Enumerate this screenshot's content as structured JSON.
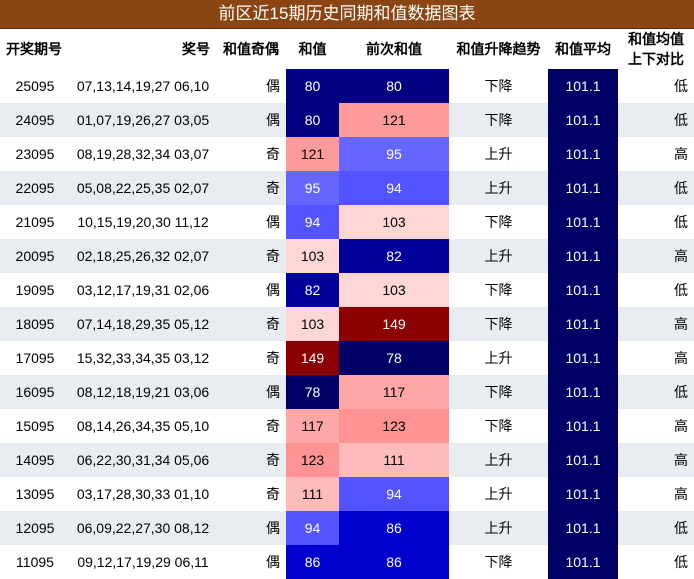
{
  "title": "前区近15期历史同期和值数据图表",
  "headers": [
    "开奖期号",
    "奖号",
    "和值奇偶",
    "和值",
    "前次和值",
    "和值升降趋势",
    "和值平均",
    "和值均值上下对比"
  ],
  "rows": [
    {
      "issue": "25095",
      "numbers": "07,13,14,19,27 06,10",
      "parity": "偶",
      "sum": 80,
      "prev": 80,
      "trend": "下降",
      "avg": "101.1",
      "cmp": "低"
    },
    {
      "issue": "24095",
      "numbers": "01,07,19,26,27 03,05",
      "parity": "偶",
      "sum": 80,
      "prev": 121,
      "trend": "下降",
      "avg": "101.1",
      "cmp": "低"
    },
    {
      "issue": "23095",
      "numbers": "08,19,28,32,34 03,07",
      "parity": "奇",
      "sum": 121,
      "prev": 95,
      "trend": "上升",
      "avg": "101.1",
      "cmp": "高"
    },
    {
      "issue": "22095",
      "numbers": "05,08,22,25,35 02,07",
      "parity": "奇",
      "sum": 95,
      "prev": 94,
      "trend": "上升",
      "avg": "101.1",
      "cmp": "低"
    },
    {
      "issue": "21095",
      "numbers": "10,15,19,20,30 11,12",
      "parity": "偶",
      "sum": 94,
      "prev": 103,
      "trend": "下降",
      "avg": "101.1",
      "cmp": "低"
    },
    {
      "issue": "20095",
      "numbers": "02,18,25,26,32 02,07",
      "parity": "奇",
      "sum": 103,
      "prev": 82,
      "trend": "上升",
      "avg": "101.1",
      "cmp": "高"
    },
    {
      "issue": "19095",
      "numbers": "03,12,17,19,31 02,06",
      "parity": "偶",
      "sum": 82,
      "prev": 103,
      "trend": "下降",
      "avg": "101.1",
      "cmp": "低"
    },
    {
      "issue": "18095",
      "numbers": "07,14,18,29,35 05,12",
      "parity": "奇",
      "sum": 103,
      "prev": 149,
      "trend": "下降",
      "avg": "101.1",
      "cmp": "高"
    },
    {
      "issue": "17095",
      "numbers": "15,32,33,34,35 03,12",
      "parity": "奇",
      "sum": 149,
      "prev": 78,
      "trend": "上升",
      "avg": "101.1",
      "cmp": "高"
    },
    {
      "issue": "16095",
      "numbers": "08,12,18,19,21 03,06",
      "parity": "偶",
      "sum": 78,
      "prev": 117,
      "trend": "下降",
      "avg": "101.1",
      "cmp": "低"
    },
    {
      "issue": "15095",
      "numbers": "08,14,26,34,35 05,10",
      "parity": "奇",
      "sum": 117,
      "prev": 123,
      "trend": "下降",
      "avg": "101.1",
      "cmp": "高"
    },
    {
      "issue": "14095",
      "numbers": "06,22,30,31,34 05,06",
      "parity": "奇",
      "sum": 123,
      "prev": 111,
      "trend": "上升",
      "avg": "101.1",
      "cmp": "高"
    },
    {
      "issue": "13095",
      "numbers": "03,17,28,30,33 01,10",
      "parity": "奇",
      "sum": 111,
      "prev": 94,
      "trend": "上升",
      "avg": "101.1",
      "cmp": "高"
    },
    {
      "issue": "12095",
      "numbers": "06,09,22,27,30 08,12",
      "parity": "偶",
      "sum": 94,
      "prev": 86,
      "trend": "上升",
      "avg": "101.1",
      "cmp": "低"
    },
    {
      "issue": "11095",
      "numbers": "09,12,17,19,29 06,11",
      "parity": "偶",
      "sum": 86,
      "prev": 86,
      "trend": "下降",
      "avg": "101.1",
      "cmp": "低"
    }
  ],
  "colors": {
    "title_bg": "#8b4513",
    "avg_bg": "#000066",
    "heat_low": "#000066",
    "heat_mid": "#0000ff",
    "heat_high": "#8b0000"
  }
}
